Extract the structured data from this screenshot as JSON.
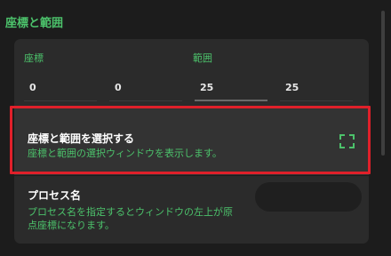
{
  "section": {
    "title": "座標と範囲"
  },
  "coords": {
    "label": "座標",
    "x": "0",
    "y": "0"
  },
  "range": {
    "label": "範囲",
    "width": "25",
    "height": "25"
  },
  "select_region": {
    "title": "座標と範囲を選択する",
    "description": "座標と範囲の選択ウィンドウを表示します。",
    "icon": "dashed-square-select-icon"
  },
  "process": {
    "title": "プロセス名",
    "description": "プロセス名を指定するとウィンドウの左上が原点座標になります。",
    "value": ""
  },
  "colors": {
    "accent": "#4cc26b",
    "highlight": "#e0202a",
    "background": "#1c1c1c"
  }
}
